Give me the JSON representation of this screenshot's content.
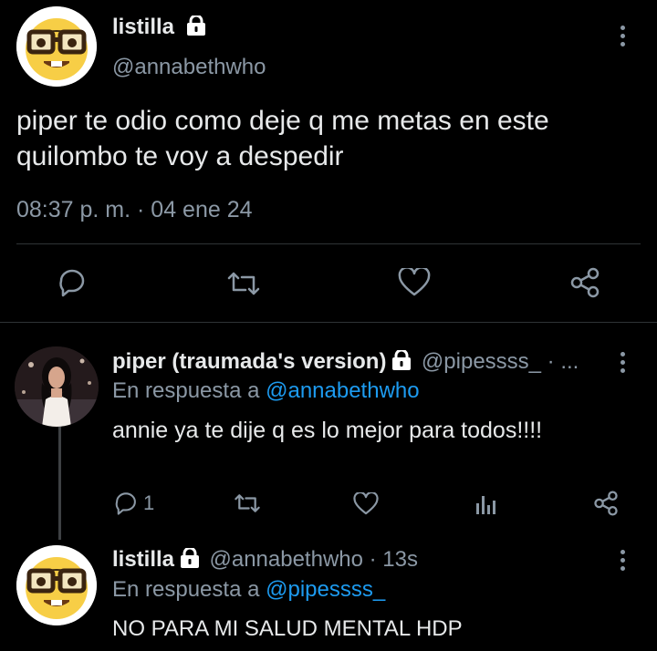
{
  "main_tweet": {
    "display_name": "listilla",
    "handle": "@annabethwho",
    "text_line1": "piper te odio como deje q me metas en este",
    "text_line2": "quilombo te voy a despedir",
    "timestamp": "08:37 p. m. · 04 ene 24"
  },
  "reply1": {
    "display_name": "piper (traumada's version)",
    "handle_meta": "@pipessss_ · ...",
    "reply_prefix": "En respuesta a",
    "reply_to": "@annabethwho",
    "text": "annie ya te dije q es lo mejor para todos!!!!",
    "reply_count": "1"
  },
  "reply2": {
    "display_name": "listilla",
    "handle_meta": "@annabethwho · 13s",
    "reply_prefix": "En respuesta a",
    "reply_to": "@pipessss_",
    "text": "NO PARA MI SALUD MENTAL HDP"
  },
  "colors": {
    "background": "#000000",
    "text": "#e7e9ea",
    "muted": "#8b98a5",
    "link": "#1d9bf0",
    "divider": "#2f3336"
  }
}
